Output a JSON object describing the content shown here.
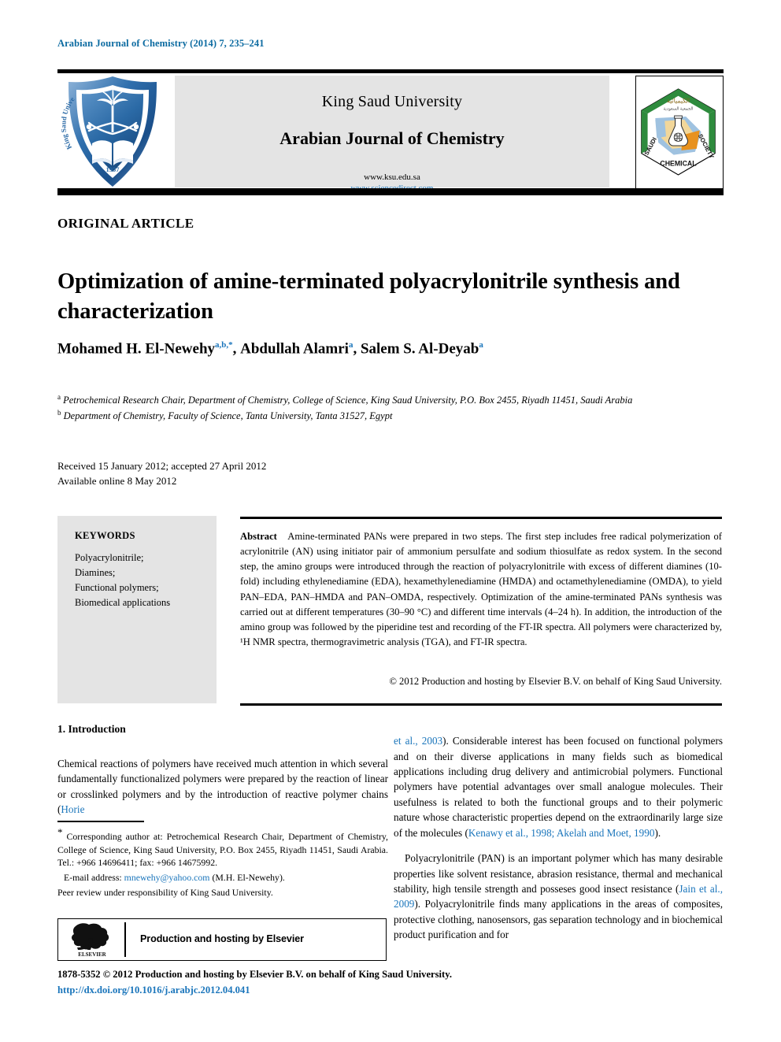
{
  "running_head": "Arabian Journal of Chemistry (2014) 7, 235–241",
  "masthead": {
    "university": "King Saud University",
    "journal_title": "Arabian Journal of Chemistry",
    "url_ksu": "www.ksu.edu.sa",
    "url_sciencedirect": "www.sciencedirect.com",
    "left_logo_name": "king-saud-university-shield-logo",
    "left_logo_text_en": "King Saud University",
    "left_logo_year": "1957",
    "right_logo_name": "saudi-chemical-society-logo",
    "right_logo_text": [
      "SAUDI",
      "SOCIETY",
      "CHEMICAL"
    ]
  },
  "article_type": "ORIGINAL ARTICLE",
  "title": "Optimization of amine-terminated polyacrylonitrile synthesis and characterization",
  "authors": [
    {
      "name": "Mohamed H. El-Newehy",
      "marks": "a,b,*"
    },
    {
      "name": "Abdullah Alamri",
      "marks": "a"
    },
    {
      "name": "Salem S. Al-Deyab",
      "marks": "a"
    }
  ],
  "affiliations": [
    {
      "mark": "a",
      "text": "Petrochemical Research Chair, Department of Chemistry, College of Science, King Saud University, P.O. Box 2455, Riyadh 11451, Saudi Arabia"
    },
    {
      "mark": "b",
      "text": "Department of Chemistry, Faculty of Science, Tanta University, Tanta 31527, Egypt"
    }
  ],
  "dates": {
    "received_accepted": "Received 15 January 2012; accepted 27 April 2012",
    "available_online": "Available online 8 May 2012"
  },
  "keywords": {
    "heading": "KEYWORDS",
    "items": "Polyacrylonitrile;\nDiamines;\nFunctional polymers;\nBiomedical applications"
  },
  "abstract": {
    "label": "Abstract",
    "text": "Amine-terminated PANs were prepared in two steps. The first step includes free radical polymerization of acrylonitrile (AN) using initiator pair of ammonium persulfate and sodium thiosulfate as redox system. In the second step, the amino groups were introduced through the reaction of polyacrylonitrile with excess of different diamines (10-fold) including ethylenediamine (EDA), hexamethylenediamine (HMDA) and octamethylenediamine (OMDA), to yield PAN–EDA, PAN–HMDA and PAN–OMDA, respectively. Optimization of the amine-terminated PANs synthesis was carried out at different temperatures (30–90 °C) and different time intervals (4–24 h). In addition, the introduction of the amino group was followed by the piperidine test and recording of the FT-IR spectra. All polymers were characterized by, ¹H NMR spectra, thermogravimetric analysis (TGA), and FT-IR spectra.",
    "copyright": "© 2012 Production and hosting by Elsevier B.V. on behalf of King Saud University."
  },
  "body": {
    "section_heading": "1. Introduction",
    "left_para_1_pre": "Chemical reactions of polymers have received much attention in which several fundamentally functionalized polymers were prepared by the reaction of linear or crosslinked polymers and by the introduction of reactive polymer chains (",
    "left_para_1_ref": "Horie",
    "right_para_1_ref_start": "et al., 2003",
    "right_para_1_mid": "). Considerable interest has been focused on functional polymers and on their diverse applications in many fields such as biomedical applications including drug delivery and antimicrobial polymers. Functional polymers have potential advantages over small analogue molecules. Their usefulness is related to both the functional groups and to their polymeric nature whose characteristic properties depend on the extraordinarily large size of the molecules (",
    "right_para_1_ref_end": "Kenawy et al., 1998; Akelah and Moet, 1990",
    "right_para_1_tail": ").",
    "right_para_2_pre": "Polyacrylonitrile (PAN) is an important polymer which has many desirable properties like solvent resistance, abrasion resistance, thermal and mechanical stability, high tensile strength and posseses good insect resistance (",
    "right_para_2_ref": "Jain et al., 2009",
    "right_para_2_tail": "). Polyacrylonitrile finds many applications in the areas of composites, protective clothing, nanosensors, gas separation technology and in biochemical product purification and for"
  },
  "footnote": {
    "corresponding": "Corresponding author at: Petrochemical Research Chair, Department of Chemistry, College of Science, King Saud University, P.O. Box 2455, Riyadh 11451, Saudi Arabia. Tel.: +966 14696411; fax: +966 14675992.",
    "email_label": "E-mail address:",
    "email": "mnewehy@yahoo.com",
    "email_suffix": "(M.H. El-Newehy).",
    "peer_review": "Peer review under responsibility of King Saud University."
  },
  "elsevier_box": {
    "label": "Production and hosting by Elsevier",
    "logo_word": "ELSEVIER"
  },
  "footer": {
    "issn_line": "1878-5352 © 2012 Production and hosting by Elsevier B.V. on behalf of King Saud University.",
    "doi": "http://dx.doi.org/10.1016/j.arabjc.2012.04.041"
  },
  "colors": {
    "link_blue": "#1a75bb",
    "head_blue": "#0c6ba1",
    "panel_gray": "#e4e4e4",
    "rule_black": "#000000"
  }
}
